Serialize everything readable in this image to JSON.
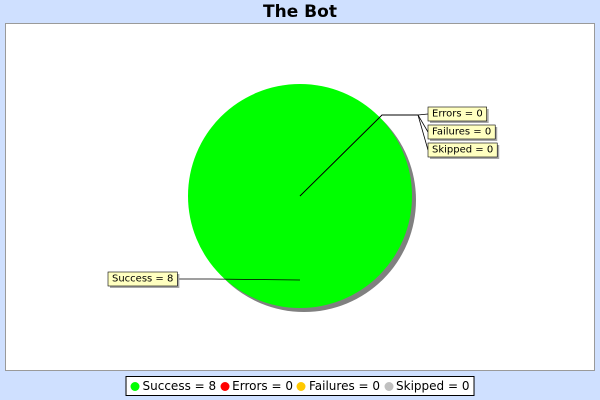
{
  "chart_data": {
    "type": "pie",
    "title": "The Bot",
    "categories": [
      "Success",
      "Errors",
      "Failures",
      "Skipped"
    ],
    "values": [
      8,
      0,
      0,
      0
    ],
    "labels": [
      "Success = 8",
      "Errors = 0",
      "Failures = 0",
      "Skipped = 0"
    ],
    "colors": [
      "#00ff00",
      "#ff0000",
      "#ffc800",
      "#c0c0c0"
    ],
    "legend_position": "bottom"
  }
}
